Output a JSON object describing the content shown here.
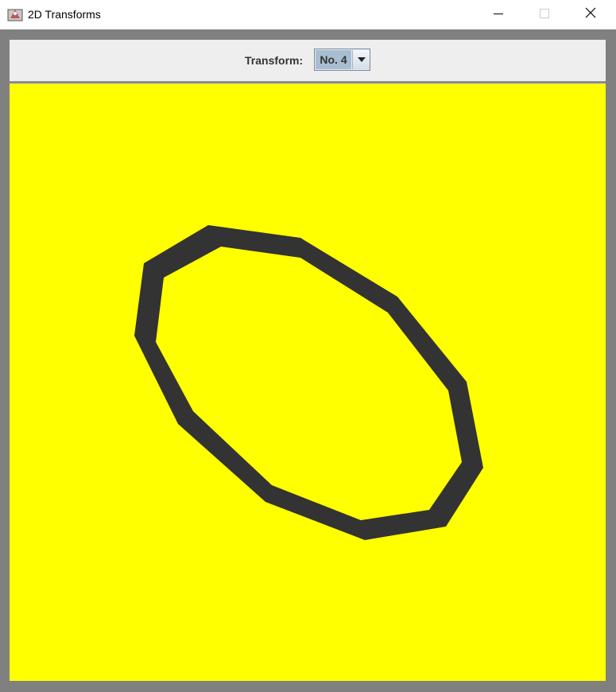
{
  "window": {
    "title": "2D Transforms",
    "icons": {
      "app": "java-app-icon",
      "minimize": "minimize-icon",
      "maximize": "maximize-icon",
      "close": "close-icon"
    }
  },
  "toolbar": {
    "transform_label": "Transform:",
    "transform_value": "No. 4",
    "dropdown_icon": "chevron-down-icon"
  },
  "canvas": {
    "background_color": "#ffff00",
    "shape_color": "#333333",
    "shape": "transformed polygon outline"
  }
}
